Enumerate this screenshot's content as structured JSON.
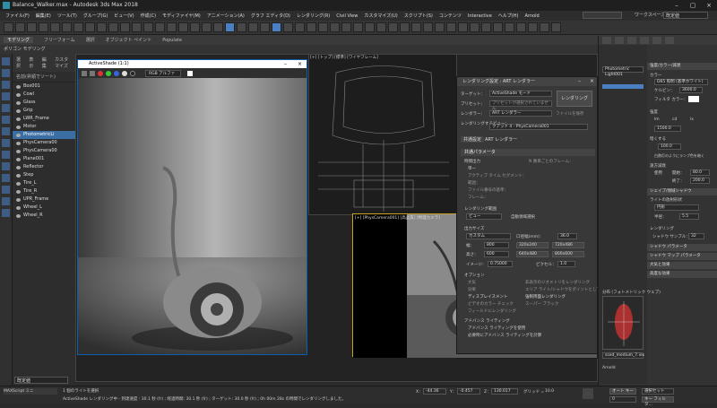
{
  "window": {
    "title": "Balance_Walker.max - Autodesk 3ds Max 2018"
  },
  "menu": [
    "ファイル(F)",
    "編集(E)",
    "ツール(T)",
    "グループ(G)",
    "ビュー(V)",
    "作成(C)",
    "モディファイヤ(M)",
    "アニメーション(A)",
    "グラフ エディタ(D)",
    "レンダリング(R)",
    "Civil View",
    "カスタマイズ(U)",
    "スクリプト(S)",
    "コンテンツ",
    "Interactive",
    "ヘルプ(H)",
    "Arnold"
  ],
  "user": {
    "workspace_label": "ワークスペース：",
    "workspace_value": "既定値"
  },
  "ribbon": {
    "tabs": [
      "モデリング",
      "フリーフォーム",
      "選択",
      "オブジェクト ペイント",
      "Populate"
    ],
    "sub": "ポリゴン モデリング"
  },
  "scene": {
    "tabs": [
      "選択",
      "表示",
      "編集",
      "カスタマイズ"
    ],
    "header": "名前(昇順でソート)",
    "items": [
      "Box001",
      "Cowl",
      "Glass",
      "Grip",
      "LWR_Frame",
      "Motor",
      "PhotometricLi",
      "PhysCamera00",
      "PhysCamera00",
      "Plane001",
      "Reflector",
      "Step",
      "Tire_L",
      "Tire_R",
      "UPR_Frame",
      "Wheel_L",
      "Wheel_R"
    ],
    "selected_index": 6,
    "footer": "既定値"
  },
  "activeshade": {
    "title": "ActiveShade (1:1)",
    "channel": "RGB アルファ"
  },
  "viewports": {
    "top_label": "[+] [トップ] [標準] [ワイヤフレーム]",
    "front_label": "[+] [フロント]",
    "camera_label": "[+] [PhysCamera001] [高品質] [物理カメラ]"
  },
  "render_dialog": {
    "title": "レンダリング設定 : ART レンダラー",
    "target_label": "ターゲット：",
    "target_value": "ActiveShade モード",
    "preset_label": "プリセット：",
    "preset_value": "プリセットが選択されていません",
    "renderer_label": "レンダラー：",
    "renderer_value": "ART レンダラー",
    "save_file": "ファイルを保存",
    "view_label": "レンダリングするビュー：",
    "view_value": "クアッド 4 - PhysCamera001",
    "render_button": "レンダリング",
    "tabs": [
      "共通設定",
      "ART レンダラー"
    ],
    "section_common": "共通パラメータ",
    "time_output": "時間出力",
    "single": "単一",
    "active_segment": "アクティブ タイム セグメント：",
    "range": "範囲：",
    "frames": "フレーム：",
    "file_number": "ファイル番号の基準：",
    "every_n": "N 番目ごとのフレーム：",
    "area_label": "レンダリング範囲",
    "area_value": "ビュー",
    "auto_region": "自動領域選択",
    "output_size": "出力サイズ",
    "size_preset": "カスタム",
    "aperture_label": "口径幅(mm)：",
    "aperture": "36.0",
    "width_label": "幅：",
    "width": "800",
    "height_label": "高さ：",
    "height": "600",
    "res_presets": [
      "320x240",
      "720x486",
      "640x480",
      "800x600"
    ],
    "aspect_label": "イメージ：",
    "aspect": "0.75000",
    "pixel_aspect_label": "ピクセル：",
    "pixel_aspect": "1.0",
    "options": "オプション",
    "opt_items": [
      "大気",
      "効果",
      "ディスプレイスメント",
      "ビデオのカラー チェック",
      "フィールドにレンダリング",
      "非表示のジオメトリをレンダリング",
      "エリア ライト/シャドウをポイントとしてレンダリング",
      "強制両面レンダリング",
      "スーパー ブラック"
    ],
    "adv_lighting": "アドバンス ライティング",
    "adv_use": "アドバンス ライティングを使用",
    "adv_compute": "必要時にアドバンス ライティングを計算"
  },
  "command_panel": {
    "object_name": "Photometric Light001",
    "sections": [
      "強度/カラー/減衰",
      "シェイプ/領域シャドウ",
      "シャドウ パラメータ",
      "シャドウ マップ パラメータ",
      "大気と効果",
      "高度な効果"
    ],
    "color_label": "カラー",
    "color_preset": "D65 照明 (基準ホワイト)",
    "kelvin_label": "ケルビン：",
    "kelvin": "3600.0",
    "filter_label": "フィルタ カラー：",
    "intensity": "強度",
    "lm": "lm",
    "cd": "cd",
    "lx": "lx",
    "intensity_value": "1500.0",
    "dimming": "暗くする",
    "percent": "100.0",
    "incandescent": "白熱灯のようにランプ色を暗く",
    "far_atten": "遠方減衰",
    "use": "使用",
    "start_label": "開始：",
    "start": "80.0",
    "end_label": "終了：",
    "end": "200.0",
    "emit_label": "ライトの放射形状",
    "emit_value": "円形",
    "radius_label": "半径：",
    "radius": "5.5",
    "render_label": "レンダリング",
    "shadow_sample_label": "シャドウ サンプル：",
    "shadow_sample": "32",
    "web_label": "分布 (フォトメトリック ウェブ)",
    "web_file": "ssed_medium_7.ies",
    "arnold": "Arnold"
  },
  "status": {
    "count": "1 個のライトを選択",
    "message": "ActiveShade レンダリング中 - 到達速度 : 30.1 秒 (fr) ; 経過時間: 30.1 秒 (fr) ; ターゲット: 30.0 秒 (fr) ; 0h 00m 28s の時間でレンダリングしました。",
    "maxscript": "MAXScript ミニ",
    "x_label": "X：",
    "x": "-44.36",
    "y_label": "Y：",
    "y": "-0.457",
    "z_label": "Z：",
    "z": "130.017",
    "grid_label": "グリッド =",
    "grid": "10.0",
    "autokey": "オート キー",
    "setkey": "キー フィルタ…",
    "selection": "選択セット",
    "frame": "0"
  }
}
